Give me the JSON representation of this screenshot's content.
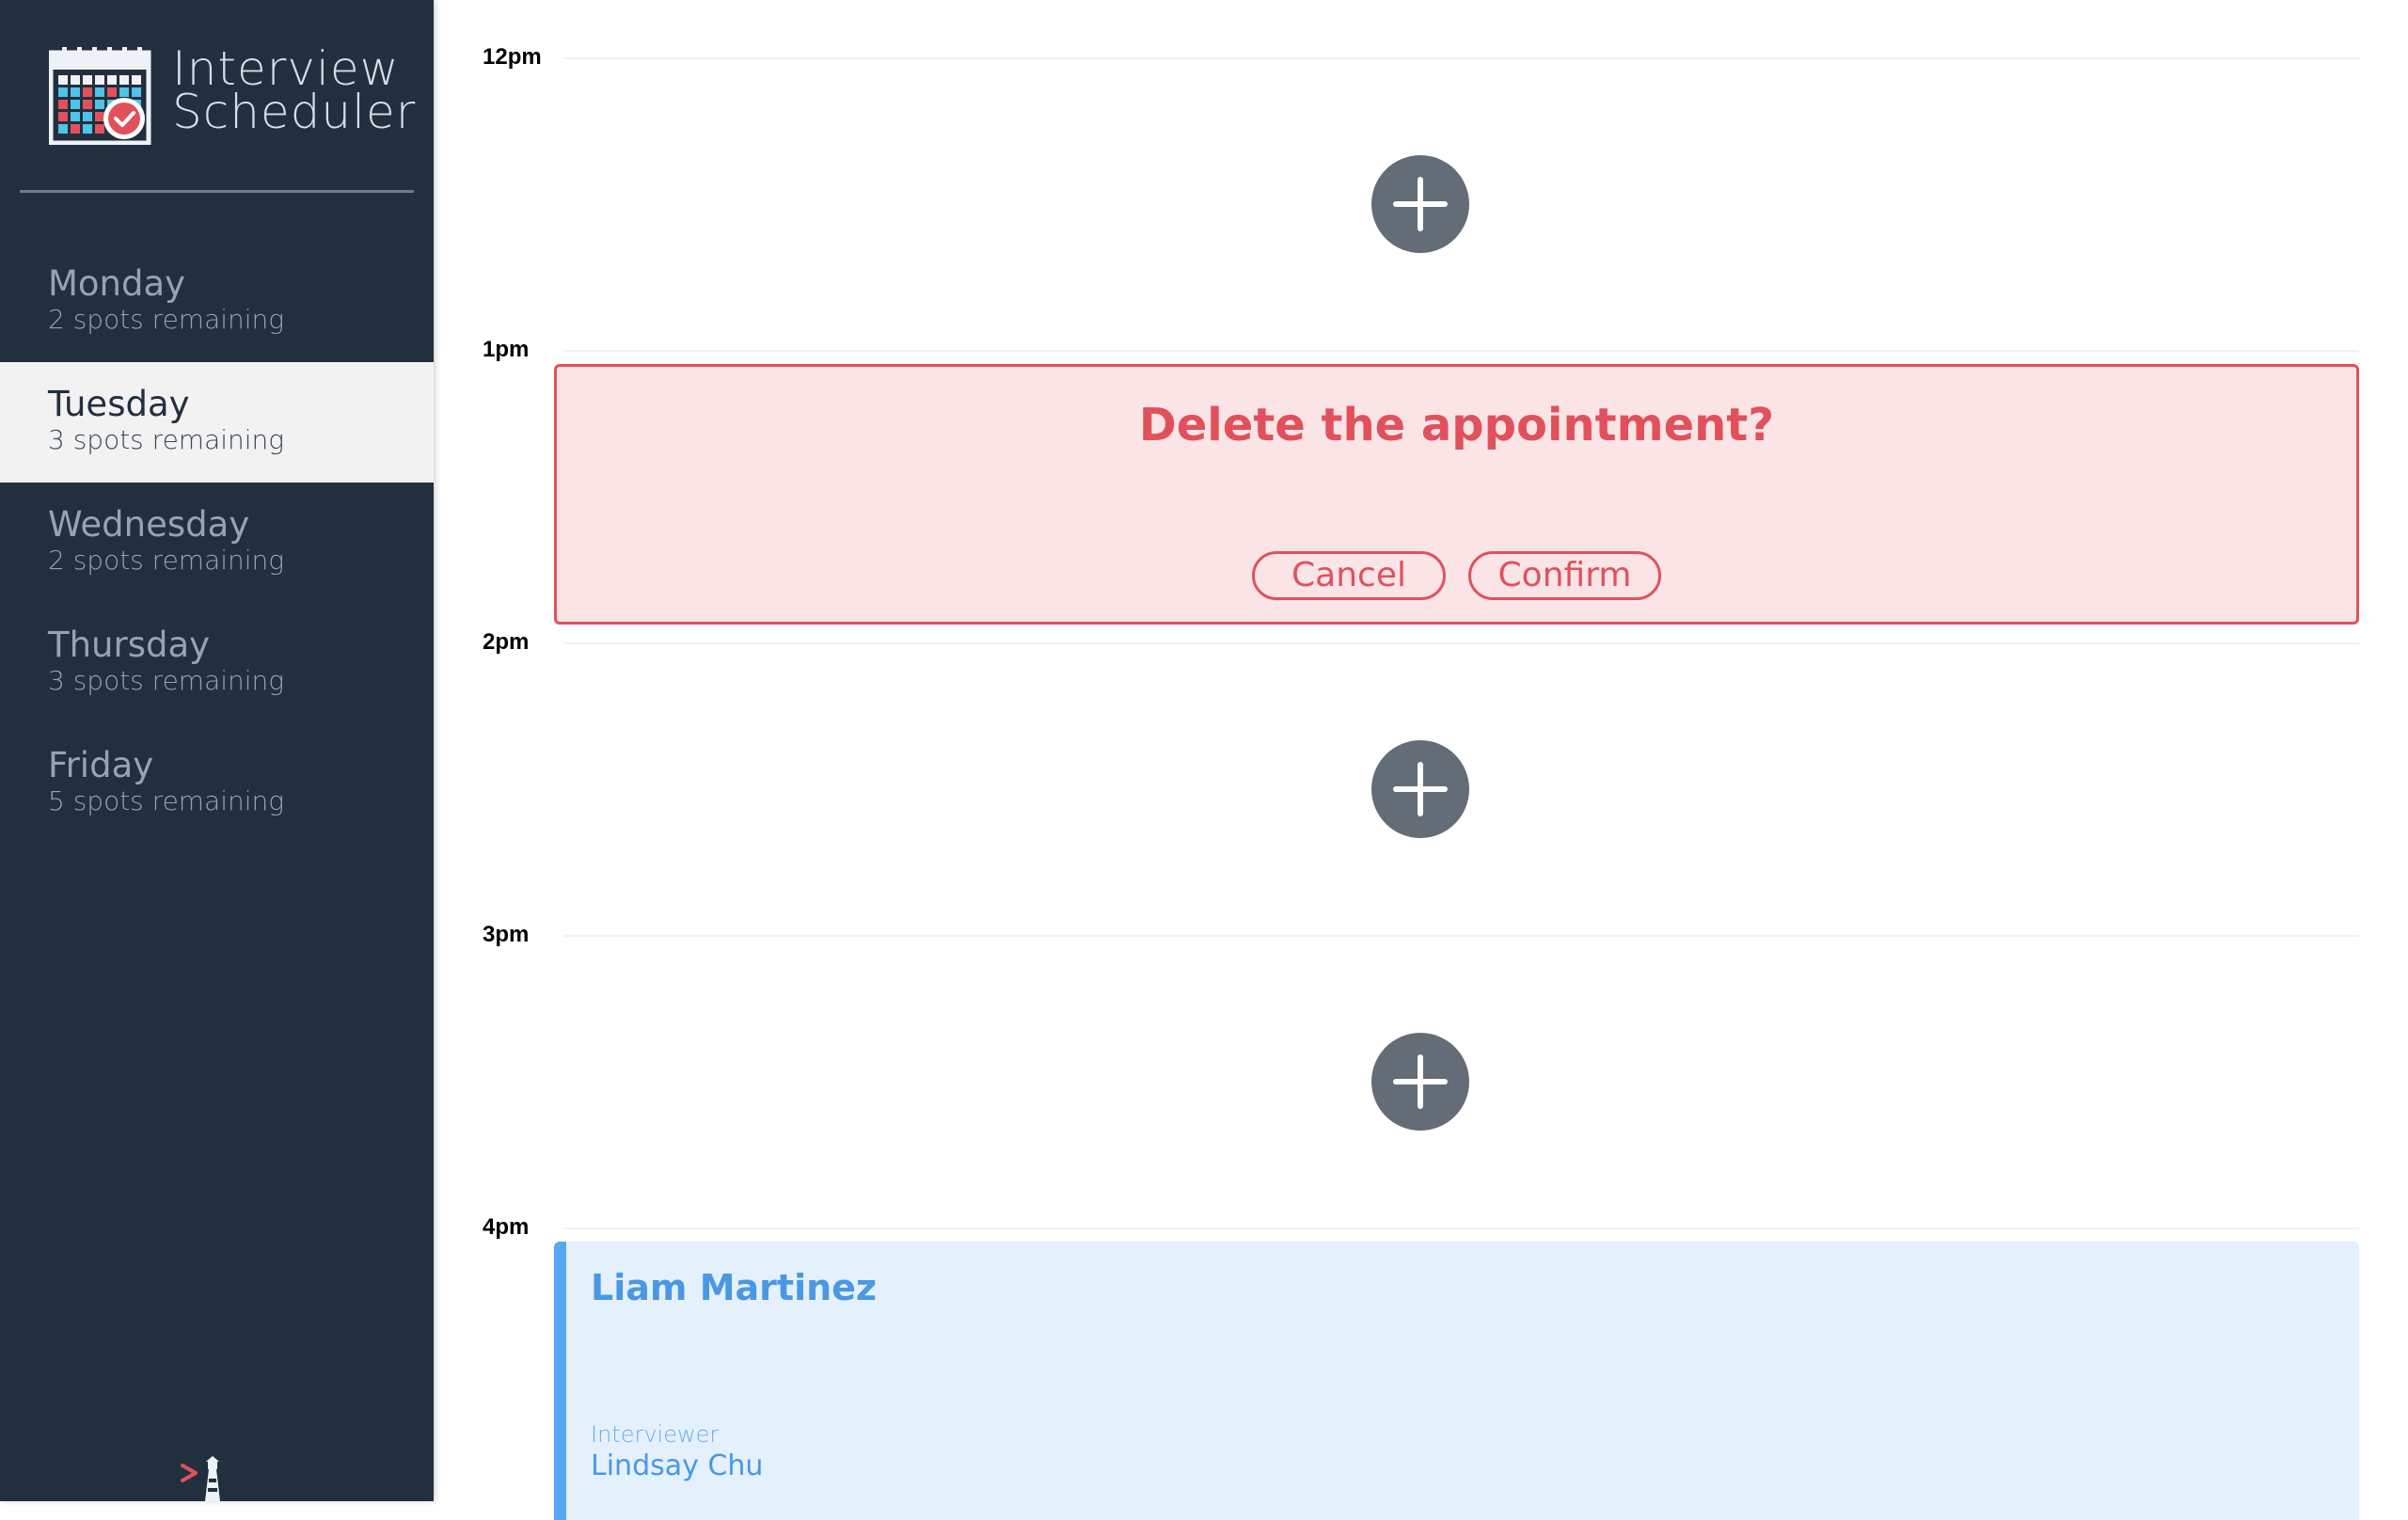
{
  "app": {
    "title_line1": "Interview",
    "title_line2": "Scheduler"
  },
  "days": [
    {
      "name": "Monday",
      "spots": "2 spots remaining",
      "selected": false
    },
    {
      "name": "Tuesday",
      "spots": "3 spots remaining",
      "selected": true
    },
    {
      "name": "Wednesday",
      "spots": "2 spots remaining",
      "selected": false
    },
    {
      "name": "Thursday",
      "spots": "3 spots remaining",
      "selected": false
    },
    {
      "name": "Friday",
      "spots": "5 spots remaining",
      "selected": false
    }
  ],
  "slots": [
    {
      "time": "12pm",
      "state": "empty"
    },
    {
      "time": "1pm",
      "state": "confirm"
    },
    {
      "time": "2pm",
      "state": "empty"
    },
    {
      "time": "3pm",
      "state": "empty"
    },
    {
      "time": "4pm",
      "state": "booked"
    }
  ],
  "confirm_dialog": {
    "message": "Delete the appointment?",
    "cancel_label": "Cancel",
    "confirm_label": "Confirm"
  },
  "booked_appointment": {
    "student": "Liam Martinez",
    "interviewer_caption": "Interviewer",
    "interviewer": "Lindsay Chu"
  },
  "colors": {
    "sidebar_bg": "#222f3e",
    "danger": "#e0515c",
    "danger_bg": "#fae4e6",
    "booked_accent": "#56a8f2",
    "booked_bg": "#e4f0fb",
    "add_button": "#646c77"
  },
  "icons": {
    "logo": "calendar-check-logo-icon",
    "add": "plus-icon",
    "footer": "lighthouse-labs-logo-icon"
  }
}
